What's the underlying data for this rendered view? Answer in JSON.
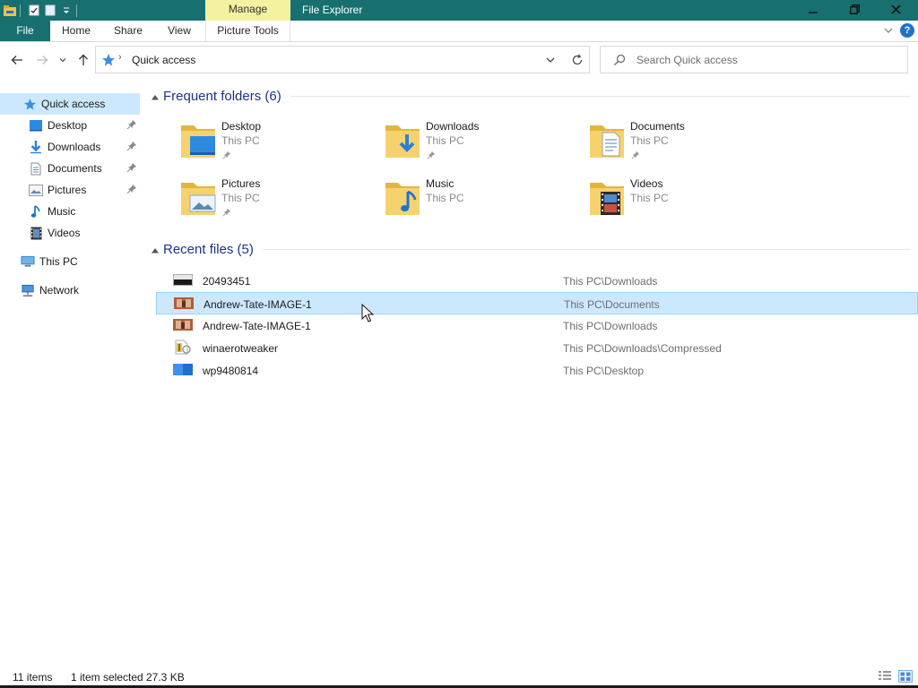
{
  "window": {
    "title": "File Explorer",
    "context_tab": "Manage",
    "accent": "#17706f"
  },
  "ribbon": {
    "tabs": {
      "file": "File",
      "home": "Home",
      "share": "Share",
      "view": "View",
      "picture_tools": "Picture Tools"
    },
    "help": "?"
  },
  "address": {
    "crumb": "Quick access",
    "separator": "›"
  },
  "search": {
    "placeholder": "Search Quick access"
  },
  "nav_pane": {
    "quick_access": "Quick access",
    "items": [
      {
        "label": "Desktop",
        "icon": "desktop-icon",
        "pinned": true
      },
      {
        "label": "Downloads",
        "icon": "download-icon",
        "pinned": true
      },
      {
        "label": "Documents",
        "icon": "document-icon",
        "pinned": true
      },
      {
        "label": "Pictures",
        "icon": "pictures-icon",
        "pinned": true
      },
      {
        "label": "Music",
        "icon": "music-icon",
        "pinned": false
      },
      {
        "label": "Videos",
        "icon": "video-icon",
        "pinned": false
      }
    ],
    "this_pc": "This PC",
    "network": "Network"
  },
  "frequent": {
    "title": "Frequent folders (6)",
    "folders": [
      {
        "name": "Desktop",
        "location": "This PC",
        "icon": "desktop-folder-icon",
        "pinned": true
      },
      {
        "name": "Downloads",
        "location": "This PC",
        "icon": "downloads-folder-icon",
        "pinned": true
      },
      {
        "name": "Documents",
        "location": "This PC",
        "icon": "documents-folder-icon",
        "pinned": true
      },
      {
        "name": "Pictures",
        "location": "This PC",
        "icon": "pictures-folder-icon",
        "pinned": true
      },
      {
        "name": "Music",
        "location": "This PC",
        "icon": "music-folder-icon",
        "pinned": false
      },
      {
        "name": "Videos",
        "location": "This PC",
        "icon": "videos-folder-icon",
        "pinned": false
      }
    ]
  },
  "recent": {
    "title": "Recent files (5)",
    "files": [
      {
        "name": "20493451",
        "location": "This PC\\Downloads",
        "selected": false
      },
      {
        "name": "Andrew-Tate-IMAGE-1",
        "location": "This PC\\Documents",
        "selected": true
      },
      {
        "name": "Andrew-Tate-IMAGE-1",
        "location": "This PC\\Downloads",
        "selected": false
      },
      {
        "name": "winaerotweaker",
        "location": "This PC\\Downloads\\Compressed",
        "selected": false
      },
      {
        "name": "wp9480814",
        "location": "This PC\\Desktop",
        "selected": false
      }
    ]
  },
  "status": {
    "items": "11 items",
    "selected": "1 item selected",
    "size": "27.3 KB"
  }
}
